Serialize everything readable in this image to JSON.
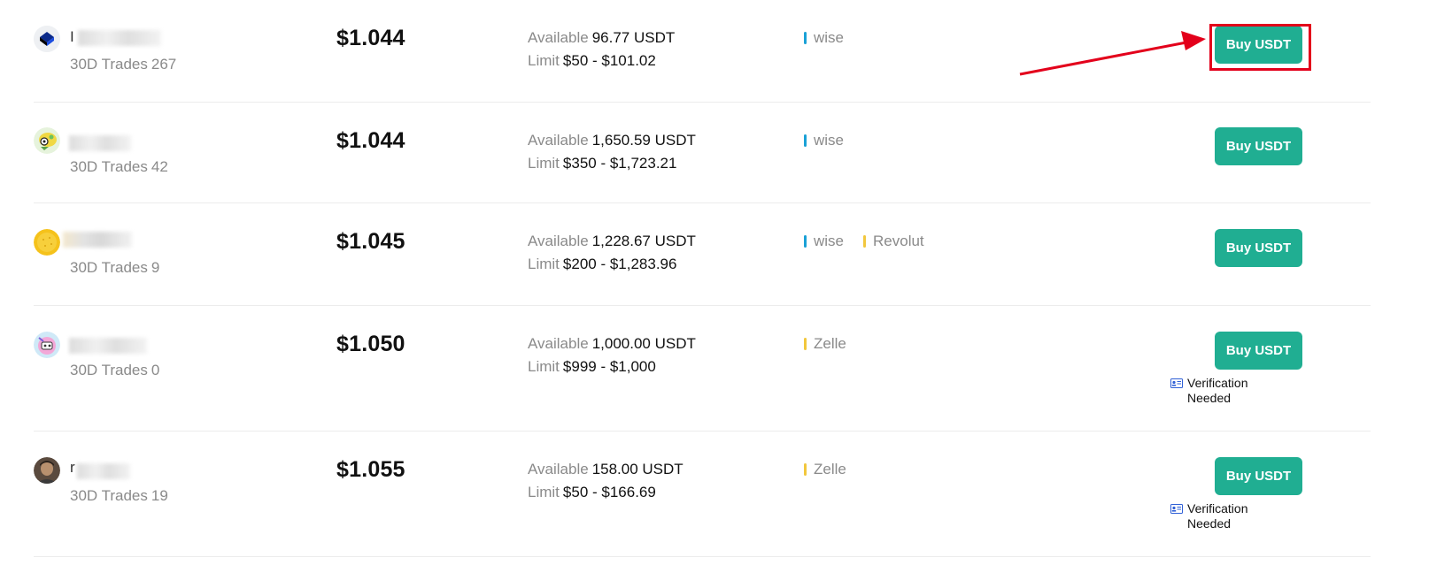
{
  "colors": {
    "buy_button": "#20ae92",
    "wise_bar": "#1aa1d6",
    "revolut_bar": "#f2c73d",
    "zelle_bar": "#f2c73d",
    "highlight": "#e3001b",
    "verify_icon": "#2e5fd6"
  },
  "offers": [
    {
      "avatar_icon": "binance-cube-avatar",
      "name_initial": "I",
      "trades_label": "30D Trades",
      "trades_count": "267",
      "price": "$1.044",
      "available_label": "Available",
      "available_value": "96.77 USDT",
      "limit_label": "Limit",
      "limit_value": "$50 - $101.02",
      "payment_methods": [
        {
          "name": "wise",
          "color": "#1aa1d6"
        }
      ],
      "button_label": "Buy USDT",
      "verification_text": ""
    },
    {
      "avatar_icon": "cartoon-avatar",
      "name_initial": "",
      "trades_label": "30D Trades",
      "trades_count": "42",
      "price": "$1.044",
      "available_label": "Available",
      "available_value": "1,650.59 USDT",
      "limit_label": "Limit",
      "limit_value": "$350 - $1,723.21",
      "payment_methods": [
        {
          "name": "wise",
          "color": "#1aa1d6"
        }
      ],
      "button_label": "Buy USDT",
      "verification_text": ""
    },
    {
      "avatar_icon": "yellow-coin-avatar",
      "name_initial": "",
      "trades_label": "30D Trades",
      "trades_count": "9",
      "price": "$1.045",
      "available_label": "Available",
      "available_value": "1,228.67 USDT",
      "limit_label": "Limit",
      "limit_value": "$200 - $1,283.96",
      "payment_methods": [
        {
          "name": "wise",
          "color": "#1aa1d6"
        },
        {
          "name": "Revolut",
          "color": "#f2c73d"
        }
      ],
      "button_label": "Buy USDT",
      "verification_text": ""
    },
    {
      "avatar_icon": "cartoon-avatar",
      "name_initial": "",
      "trades_label": "30D Trades",
      "trades_count": "0",
      "price": "$1.050",
      "available_label": "Available",
      "available_value": "1,000.00 USDT",
      "limit_label": "Limit",
      "limit_value": "$999 - $1,000",
      "payment_methods": [
        {
          "name": "Zelle",
          "color": "#f2c73d"
        }
      ],
      "button_label": "Buy USDT",
      "verification_text": "Verification Needed"
    },
    {
      "avatar_icon": "photo-avatar",
      "name_initial": "r",
      "trades_label": "30D Trades",
      "trades_count": "19",
      "price": "$1.055",
      "available_label": "Available",
      "available_value": "158.00 USDT",
      "limit_label": "Limit",
      "limit_value": "$50 - $166.69",
      "payment_methods": [
        {
          "name": "Zelle",
          "color": "#f2c73d"
        }
      ],
      "button_label": "Buy USDT",
      "verification_text": "Verification Needed"
    }
  ]
}
